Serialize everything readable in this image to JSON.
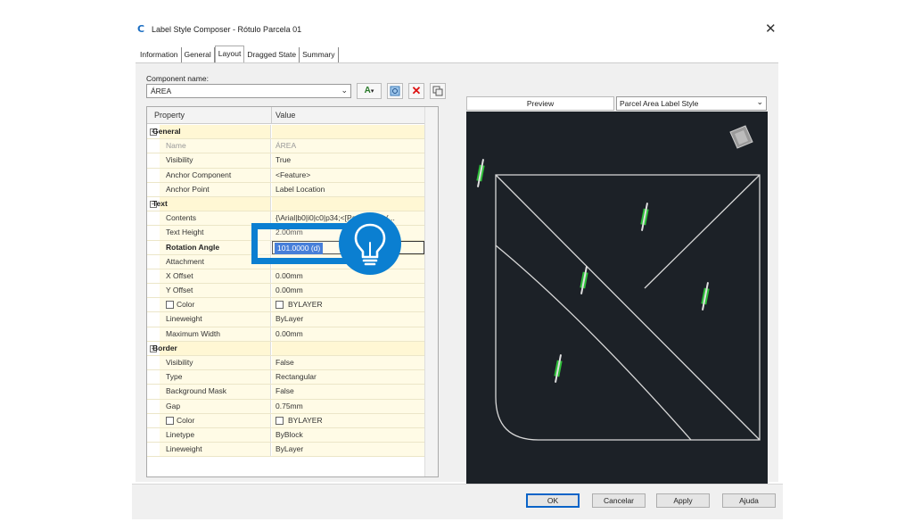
{
  "window": {
    "title": "Label Style Composer - Rótulo Parcela 01",
    "app_icon": "C",
    "close_glyph": "✕"
  },
  "tabs": [
    "Information",
    "General",
    "Layout",
    "Dragged State",
    "Summary"
  ],
  "active_tab": "Layout",
  "component": {
    "label": "Component name:",
    "value": "ÁREA"
  },
  "grid": {
    "header_property": "Property",
    "header_value": "Value",
    "rows": [
      {
        "type": "cat",
        "prop": "General"
      },
      {
        "prop": "Name",
        "value": "ÁREA",
        "dim": true
      },
      {
        "prop": "Visibility",
        "value": "True"
      },
      {
        "prop": "Anchor Component",
        "value": "<Feature>"
      },
      {
        "prop": "Anchor Point",
        "value": "Label Location"
      },
      {
        "type": "cat",
        "prop": "Text"
      },
      {
        "prop": "Contents",
        "value": "{\\Arial|b0|i0|c0|p34;<[Parcel Area(..."
      },
      {
        "prop": "Text Height",
        "value": "2.00mm"
      },
      {
        "prop": "Rotation Angle",
        "value": "101.0000 (d)",
        "bold": true,
        "selected": true
      },
      {
        "prop": "Attachment",
        "value": ""
      },
      {
        "prop": "X Offset",
        "value": "0.00mm"
      },
      {
        "prop": "Y Offset",
        "value": "0.00mm"
      },
      {
        "prop": "Color",
        "value": "BYLAYER",
        "checkbox": true
      },
      {
        "prop": "Lineweight",
        "value": "ByLayer"
      },
      {
        "prop": "Maximum Width",
        "value": "0.00mm"
      },
      {
        "type": "cat",
        "prop": "Border"
      },
      {
        "prop": "Visibility",
        "value": "False"
      },
      {
        "prop": "Type",
        "value": "Rectangular"
      },
      {
        "prop": "Background Mask",
        "value": "False"
      },
      {
        "prop": "Gap",
        "value": "0.75mm"
      },
      {
        "prop": "Color",
        "value": "BYLAYER",
        "checkbox": true
      },
      {
        "prop": "Linetype",
        "value": "ByBlock"
      },
      {
        "prop": "Lineweight",
        "value": "ByLayer"
      }
    ]
  },
  "preview": {
    "label": "Preview",
    "style_select": "Parcel Area Label Style"
  },
  "buttons": {
    "ok": "OK",
    "cancel": "Cancelar",
    "apply": "Apply",
    "help": "Ajuda"
  },
  "colors": {
    "accent_blue": "#0b7fd1",
    "canvas_bg": "#1c2127",
    "selection": "#1a5fd0",
    "label_green": "#2fbf3a"
  },
  "icons": {
    "text_add": "text-component-icon",
    "pick": "pick-icon",
    "delete": "delete-icon",
    "copy": "copy-icon",
    "bulb": "lightbulb-icon"
  }
}
